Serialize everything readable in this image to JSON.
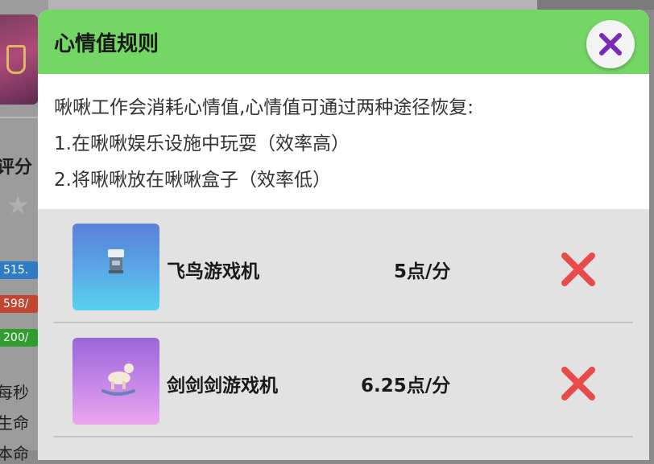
{
  "background": {
    "score_label": "评分",
    "bars": [
      "515.",
      "598/",
      "200/"
    ],
    "stat_labels": [
      "每秒",
      "生命",
      "本命"
    ]
  },
  "dialog": {
    "title": "心情值规则",
    "close_icon": "close-x-icon",
    "rules": [
      "啾啾工作会消耗心情值,心情值可通过两种途径恢复:",
      "1.在啾啾娱乐设施中玩耍（效率高）",
      "2.将啾啾放在啾啾盒子（效率低）"
    ],
    "items": [
      {
        "name": "飞鸟游戏机",
        "rate": "5点/分",
        "thumb_icon": "game-machine-icon",
        "remove_icon": "red-x-icon"
      },
      {
        "name": "剑剑剑游戏机",
        "rate": "6.25点/分",
        "thumb_icon": "rocking-horse-icon",
        "remove_icon": "red-x-icon"
      }
    ]
  },
  "colors": {
    "header": "#74d665",
    "close_x": "#7a2bb5",
    "remove_x": "#e94b4b"
  }
}
